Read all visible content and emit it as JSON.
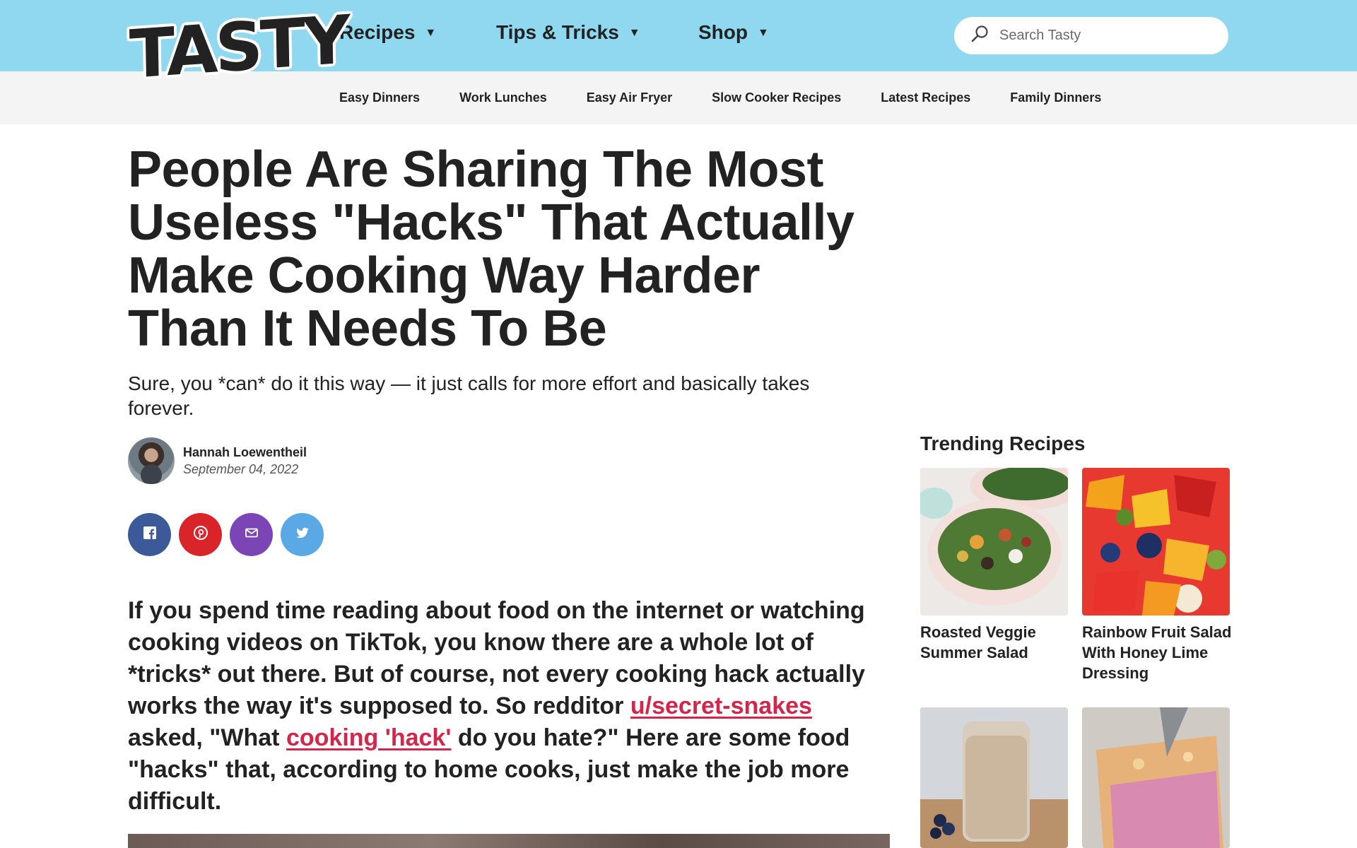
{
  "brand": {
    "logo_text": "TASTY"
  },
  "main_nav": {
    "recipes": "Recipes",
    "tips": "Tips & Tricks",
    "shop": "Shop"
  },
  "search": {
    "placeholder": "Search Tasty",
    "value": ""
  },
  "sub_nav": [
    "Easy Dinners",
    "Work Lunches",
    "Easy Air Fryer",
    "Slow Cooker Recipes",
    "Latest Recipes",
    "Family Dinners"
  ],
  "article": {
    "headline": "People Are Sharing The Most Useless \"Hacks\" That Actually Make Cooking Way Harder Than It Needs To Be",
    "dek": "Sure, you *can* do it this way — it just calls for more effort and basically takes forever.",
    "author": "Hannah Loewentheil",
    "date": "September 04, 2022",
    "body": {
      "part1": "If you spend time reading about food on the internet or watching cooking videos on TikTok, you know there are a whole lot of *tricks* out there. But of course, not every cooking hack actually works the way it's supposed to. So redditor ",
      "link1": "u/secret-snakes",
      "part2": " asked, \"What ",
      "link2": "cooking 'hack'",
      "part3": " do you hate?\" Here are some food \"hacks\" that, according to home cooks, just make the job more difficult."
    }
  },
  "share": [
    "facebook-icon",
    "pinterest-icon",
    "email-icon",
    "twitter-icon"
  ],
  "sidebar": {
    "title": "Trending Recipes",
    "cards": [
      {
        "title": "Roasted Veggie Summer Salad"
      },
      {
        "title": "Rainbow Fruit Salad With Honey Lime Dressing"
      },
      {
        "title": ""
      },
      {
        "title": ""
      }
    ]
  },
  "colors": {
    "topbar": "#8fd8ef",
    "subnav": "#f4f4f4",
    "link": "#d4264a",
    "facebook": "#3c5a99",
    "pinterest": "#d9252a",
    "email": "#7b45b5",
    "twitter": "#5aa8e6"
  }
}
